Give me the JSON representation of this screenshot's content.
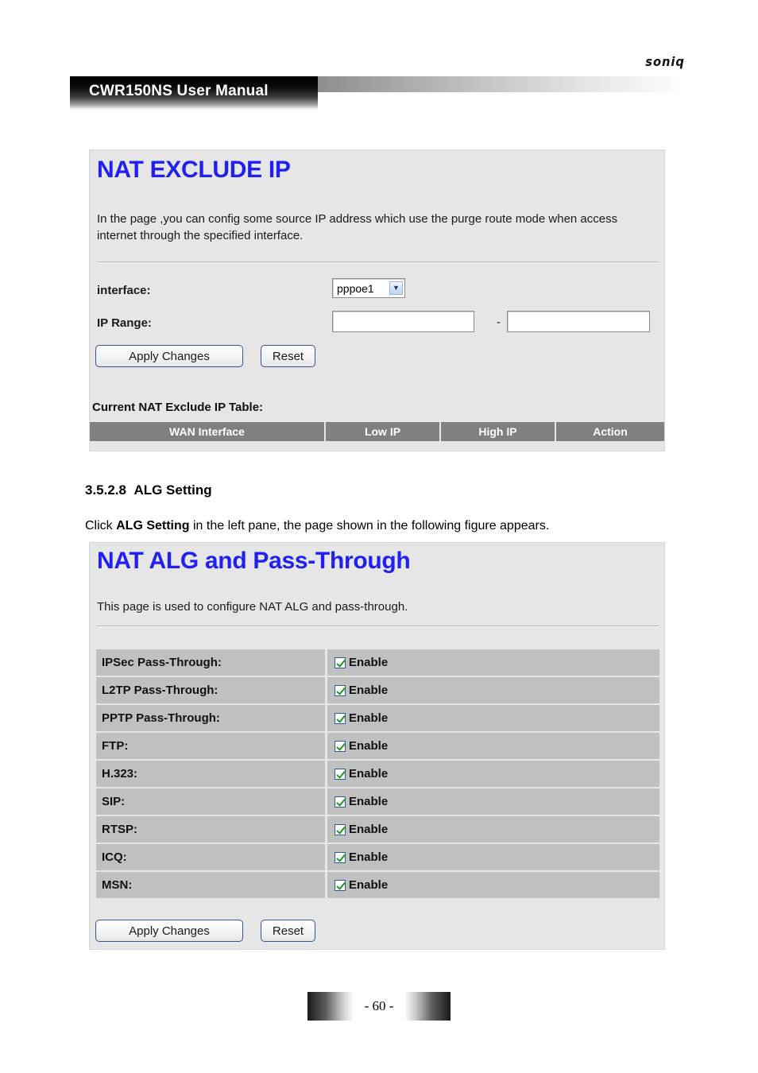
{
  "header": {
    "brand": "soniq",
    "manual_title": "CWR150NS User Manual"
  },
  "nat_exclude_panel": {
    "title": "NAT EXCLUDE IP",
    "description": "In the page ,you can config some source IP address which use the purge route mode when access internet through the specified interface.",
    "interface_label": "interface:",
    "interface_value": "pppoe1",
    "interface_options": [
      "pppoe1"
    ],
    "ip_range_label": "IP Range:",
    "ip_range_from": "",
    "ip_range_to": "",
    "range_separator": "-",
    "apply_label": "Apply Changes",
    "reset_label": "Reset",
    "table_caption": "Current NAT Exclude IP Table:",
    "table_headers": [
      "WAN Interface",
      "Low IP",
      "High IP",
      "Action"
    ],
    "table_rows": []
  },
  "section": {
    "number": "3.5.2.8",
    "heading": "ALG Setting",
    "para_before": "Click ",
    "para_bold": "ALG Setting",
    "para_after": " in the left pane, the page shown in the following figure appears."
  },
  "nat_alg_panel": {
    "title": "NAT ALG and Pass-Through",
    "description": "This page is used to configure NAT ALG and pass-through.",
    "rows": [
      {
        "label": "IPSec Pass-Through:",
        "value_label": "Enable",
        "checked": true
      },
      {
        "label": "L2TP Pass-Through:",
        "value_label": "Enable",
        "checked": true
      },
      {
        "label": "PPTP Pass-Through:",
        "value_label": "Enable",
        "checked": true
      },
      {
        "label": "FTP:",
        "value_label": "Enable",
        "checked": true
      },
      {
        "label": "H.323:",
        "value_label": "Enable",
        "checked": true
      },
      {
        "label": "SIP:",
        "value_label": "Enable",
        "checked": true
      },
      {
        "label": "RTSP:",
        "value_label": "Enable",
        "checked": true
      },
      {
        "label": "ICQ:",
        "value_label": "Enable",
        "checked": true
      },
      {
        "label": "MSN:",
        "value_label": "Enable",
        "checked": true
      }
    ],
    "apply_label": "Apply Changes",
    "reset_label": "Reset"
  },
  "footer": {
    "page_number": "- 60 -"
  },
  "colors": {
    "panel_bg": "#e6e6e6",
    "panel_title": "#2020f0",
    "table_header_bg": "#808080",
    "alg_row_bg": "#c0c0c0",
    "check_green": "#1d9a1d",
    "button_border": "#33598c"
  }
}
